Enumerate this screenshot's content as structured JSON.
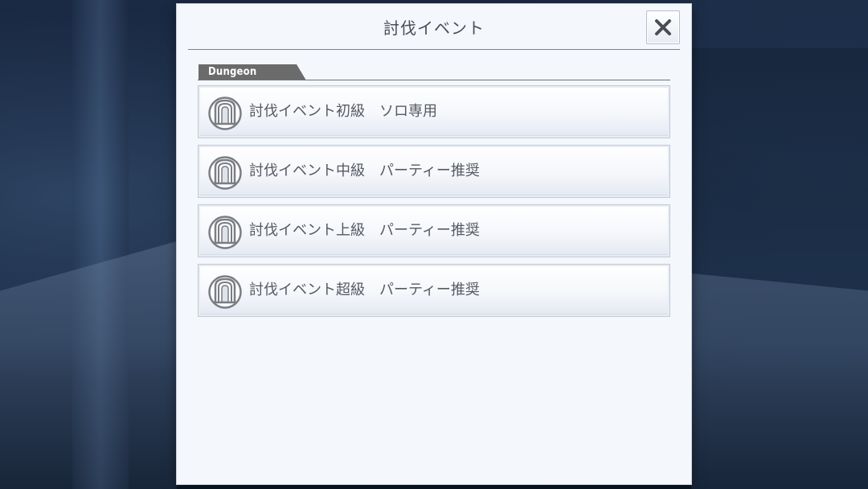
{
  "dialog": {
    "title": "討伐イベント",
    "close_icon": "close-icon"
  },
  "section": {
    "label": "Dungeon",
    "color": "#6b6b6b"
  },
  "items": [
    {
      "label": "討伐イベント初級　ソロ専用",
      "icon": "dungeon-gate-icon"
    },
    {
      "label": "討伐イベント中級　パーティー推奨",
      "icon": "dungeon-gate-icon"
    },
    {
      "label": "討伐イベント上級　パーティー推奨",
      "icon": "dungeon-gate-icon"
    },
    {
      "label": "討伐イベント超級　パーティー推奨",
      "icon": "dungeon-gate-icon"
    }
  ],
  "colors": {
    "panel": "#f4f7fc",
    "text": "#565a63",
    "accent": "#6b6b6b"
  }
}
